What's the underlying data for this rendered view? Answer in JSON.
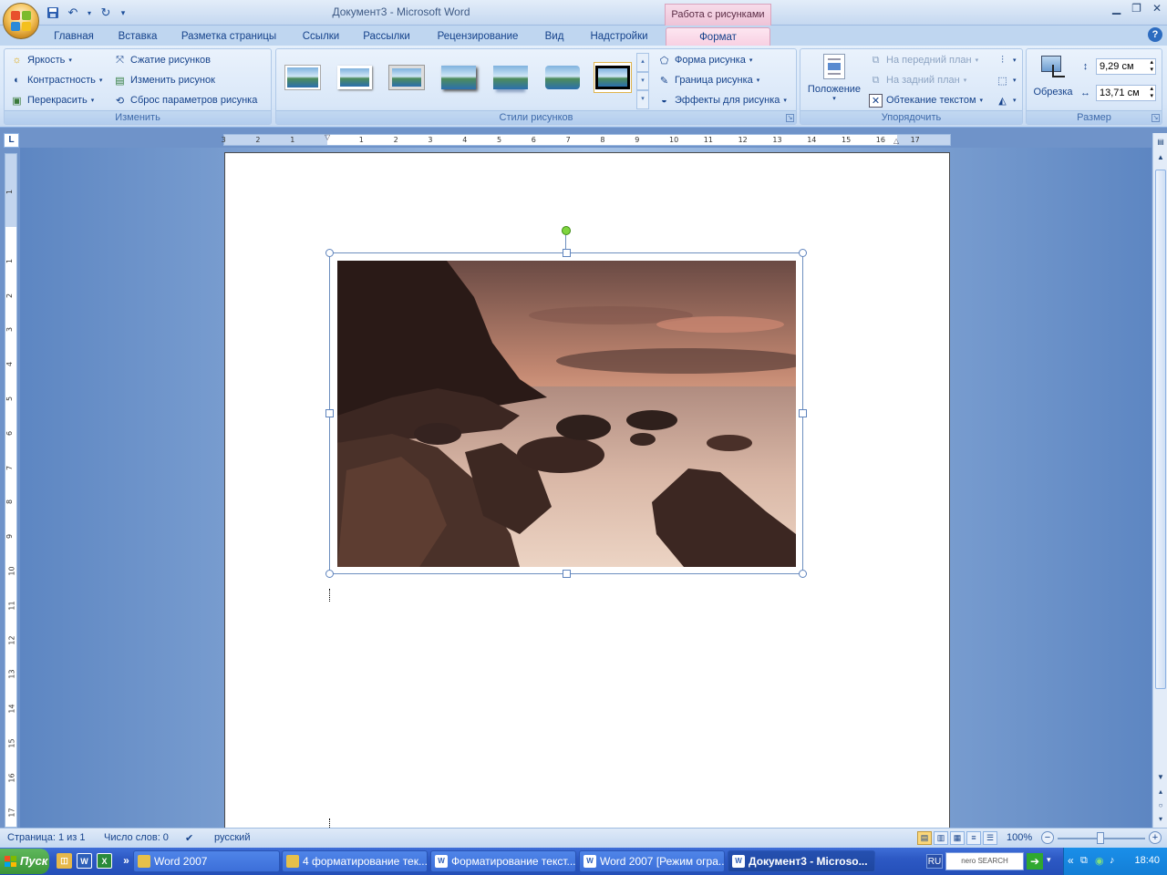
{
  "window": {
    "title": "Документ3 - Microsoft Word",
    "context_title": "Работа с рисунками"
  },
  "tabs": [
    {
      "label": "Главная"
    },
    {
      "label": "Вставка"
    },
    {
      "label": "Разметка страницы"
    },
    {
      "label": "Ссылки"
    },
    {
      "label": "Рассылки"
    },
    {
      "label": "Рецензирование"
    },
    {
      "label": "Вид"
    },
    {
      "label": "Надстройки"
    },
    {
      "label": "Формат"
    }
  ],
  "ribbon": {
    "adjust": {
      "label": "Изменить",
      "brightness": "Яркость",
      "contrast": "Контрастность",
      "recolor": "Перекрасить",
      "compress": "Сжатие рисунков",
      "change": "Изменить рисунок",
      "reset": "Сброс параметров рисунка"
    },
    "styles": {
      "label": "Стили рисунков",
      "shape": "Форма рисунка",
      "border": "Граница рисунка",
      "effects": "Эффекты для рисунка"
    },
    "arrange": {
      "label": "Упорядочить",
      "position": "Положение",
      "bring_front": "На передний план",
      "send_back": "На задний план",
      "text_wrap": "Обтекание текстом"
    },
    "size": {
      "label": "Размер",
      "crop": "Обрезка",
      "height": "9,29 см",
      "width": "13,71 см"
    }
  },
  "ruler": {
    "h_labels": [
      "3",
      "2",
      "1",
      "1",
      "2",
      "3",
      "4",
      "5",
      "6",
      "7",
      "8",
      "9",
      "10",
      "11",
      "12",
      "13",
      "14",
      "15",
      "16",
      "17"
    ],
    "v_labels": [
      "1",
      "1",
      "2",
      "3",
      "4",
      "5",
      "6",
      "7",
      "8",
      "9",
      "10",
      "11",
      "12",
      "13",
      "14",
      "15",
      "16",
      "17"
    ]
  },
  "statusbar": {
    "page": "Страница: 1 из 1",
    "words": "Число слов: 0",
    "language": "русский",
    "zoom": "100%",
    "zoom_minus": "−",
    "zoom_plus": "+"
  },
  "taskbar": {
    "start": "Пуск",
    "buttons": [
      {
        "label": "Word 2007"
      },
      {
        "label": "4 форматирование тек..."
      },
      {
        "label": "Форматирование текст..."
      },
      {
        "label": "Word 2007 [Режим огра..."
      },
      {
        "label": "Документ3 - Microso..."
      }
    ],
    "lang": "RU",
    "search": "nero SEARCH",
    "clock": "18:40"
  },
  "colors": {
    "accent": "#15428b",
    "context_tab": "#f8d0e2",
    "workspace": "#6f93c9"
  },
  "icons": [
    "office-button",
    "save-icon",
    "undo-icon",
    "redo-icon",
    "brightness-icon",
    "contrast-icon",
    "recolor-icon",
    "compress-icon",
    "change-picture-icon",
    "reset-icon",
    "shape-icon",
    "border-icon",
    "effects-icon",
    "position-icon",
    "bring-front-icon",
    "send-back-icon",
    "wrap-icon",
    "align-icon",
    "group-icon",
    "rotate-icon",
    "crop-icon",
    "height-icon",
    "width-icon",
    "help-icon"
  ]
}
